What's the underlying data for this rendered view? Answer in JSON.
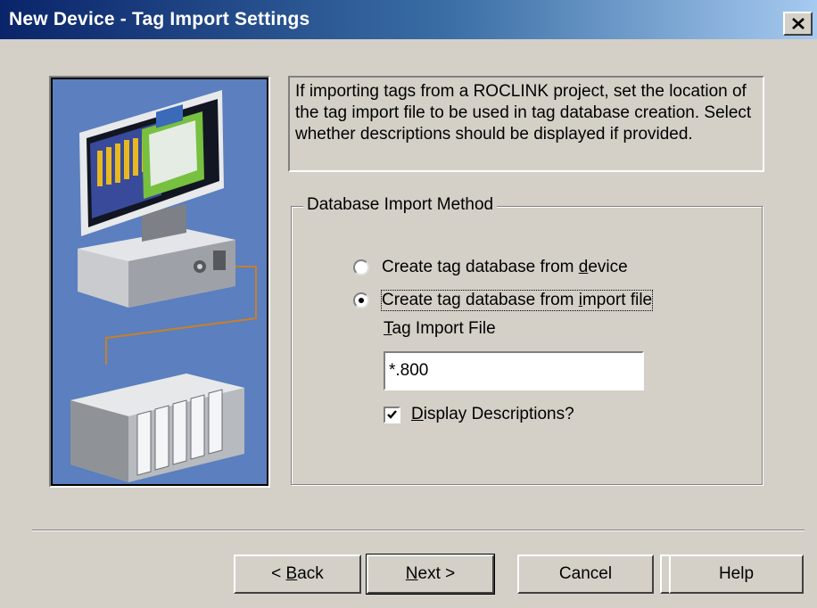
{
  "window": {
    "title": "New Device - Tag Import Settings"
  },
  "description": "If importing tags from a ROCLINK project, set the location of the tag import file to be used in tag database creation.  Select whether descriptions should be displayed if provided.",
  "group": {
    "title": "Database Import Method",
    "radios": [
      {
        "label_pre": "Create tag database from ",
        "label_key": "d",
        "label_post": "evice",
        "checked": false
      },
      {
        "label_pre": "Create tag database from ",
        "label_key": "i",
        "label_post": "mport file",
        "checked": true
      }
    ],
    "tag_import_label": {
      "key": "T",
      "rest": "ag Import File"
    },
    "tag_import_value": "*.800",
    "browse_label": "...",
    "display_descriptions": {
      "key": "D",
      "rest": "isplay Descriptions?",
      "checked": true
    }
  },
  "buttons": {
    "back": {
      "prefix": "< ",
      "key": "B",
      "rest": "ack"
    },
    "next": {
      "key": "N",
      "rest": "ext >"
    },
    "cancel": "Cancel",
    "help": "Help"
  },
  "colors": {
    "title_start": "#0a246a",
    "title_end": "#a6caf0",
    "dialog_bg": "#d4d0c8",
    "illustration_bg": "#5b7fbf"
  },
  "icons": [
    "close-icon",
    "computer-illustration",
    "checkmark-icon"
  ]
}
